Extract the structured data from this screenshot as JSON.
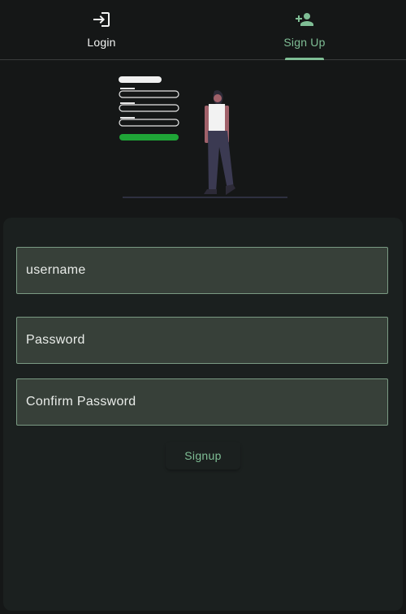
{
  "tabs": {
    "login": {
      "label": "Login",
      "icon": "login-icon",
      "selected": false
    },
    "signup": {
      "label": "Sign Up",
      "icon": "person-add-icon",
      "selected": true
    }
  },
  "illustration": {
    "name": "signup-illustration"
  },
  "form": {
    "username": {
      "placeholder": "username",
      "value": ""
    },
    "password": {
      "placeholder": "Password",
      "value": ""
    },
    "confirm_password": {
      "placeholder": "Confirm Password",
      "value": ""
    },
    "submit_label": "Signup"
  },
  "colors": {
    "background": "#151717",
    "card": "#1b201f",
    "field_fill": "#374039",
    "field_border": "#7a9a83",
    "accent": "#7fbe95",
    "text": "#f3f4f3"
  }
}
